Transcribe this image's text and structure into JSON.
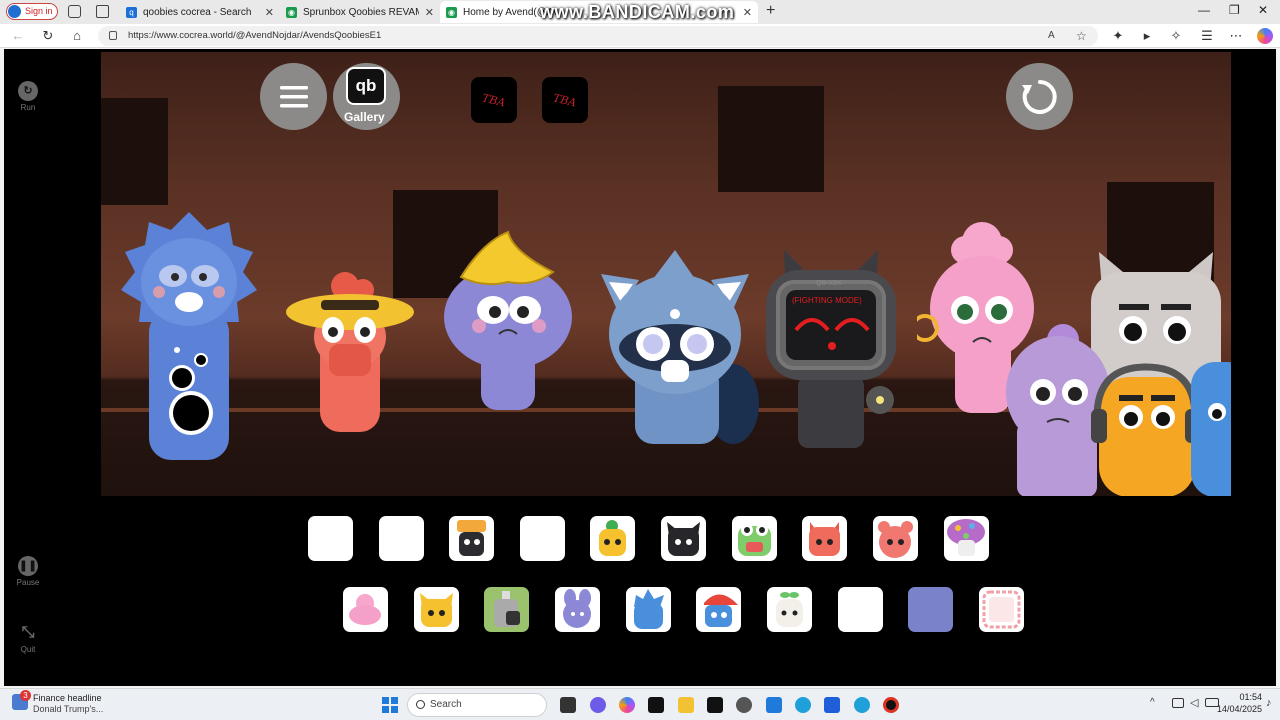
{
  "browser": {
    "profile_label": "Sign in",
    "tabs": [
      {
        "title": "qoobies cocrea - Search",
        "active": false
      },
      {
        "title": "Sprunbox Qoobies REVAMPED! b",
        "active": false
      },
      {
        "title": "Home by Avend(@Av",
        "active": true
      }
    ],
    "url": "https://www.cocrea.world/@AvendNojdar/AvendsQoobiesE1",
    "watermark": "www.BANDICAM.com"
  },
  "sidebar": {
    "run_label": "Run",
    "pause_label": "Pause",
    "quit_label": "Quit"
  },
  "stage": {
    "gallery_label": "Gallery",
    "gallery_logo": "qb",
    "tba_1": "TBA",
    "tba_2": "TBA",
    "robot_screen_top": "QB-X9X",
    "robot_screen_text": "(FIGHTING MODE)"
  },
  "palette": {
    "row1": [
      "blank",
      "blank",
      "dark-hat",
      "blank",
      "yellow-sprout",
      "black-cat",
      "frog",
      "red-horns",
      "red-bear",
      "mushroom"
    ],
    "row2": [
      "pink-blob",
      "yellow-cat",
      "green-bottle",
      "purple-bunny",
      "blue-spike",
      "red-cap",
      "white-sprout",
      "blank",
      "slate-blue",
      "red-scribble"
    ]
  },
  "taskbar": {
    "news_badge": "3",
    "news_title": "Finance headline",
    "news_subtitle": "Donald Trump's...",
    "search_placeholder": "Search",
    "time": "01:54",
    "date": "14/04/2025"
  },
  "colors": {
    "accent": "#0067c0",
    "stage_wall": "#6c3b2a",
    "slot_bg": "#ffffff",
    "tba_text": "#c0202a"
  }
}
